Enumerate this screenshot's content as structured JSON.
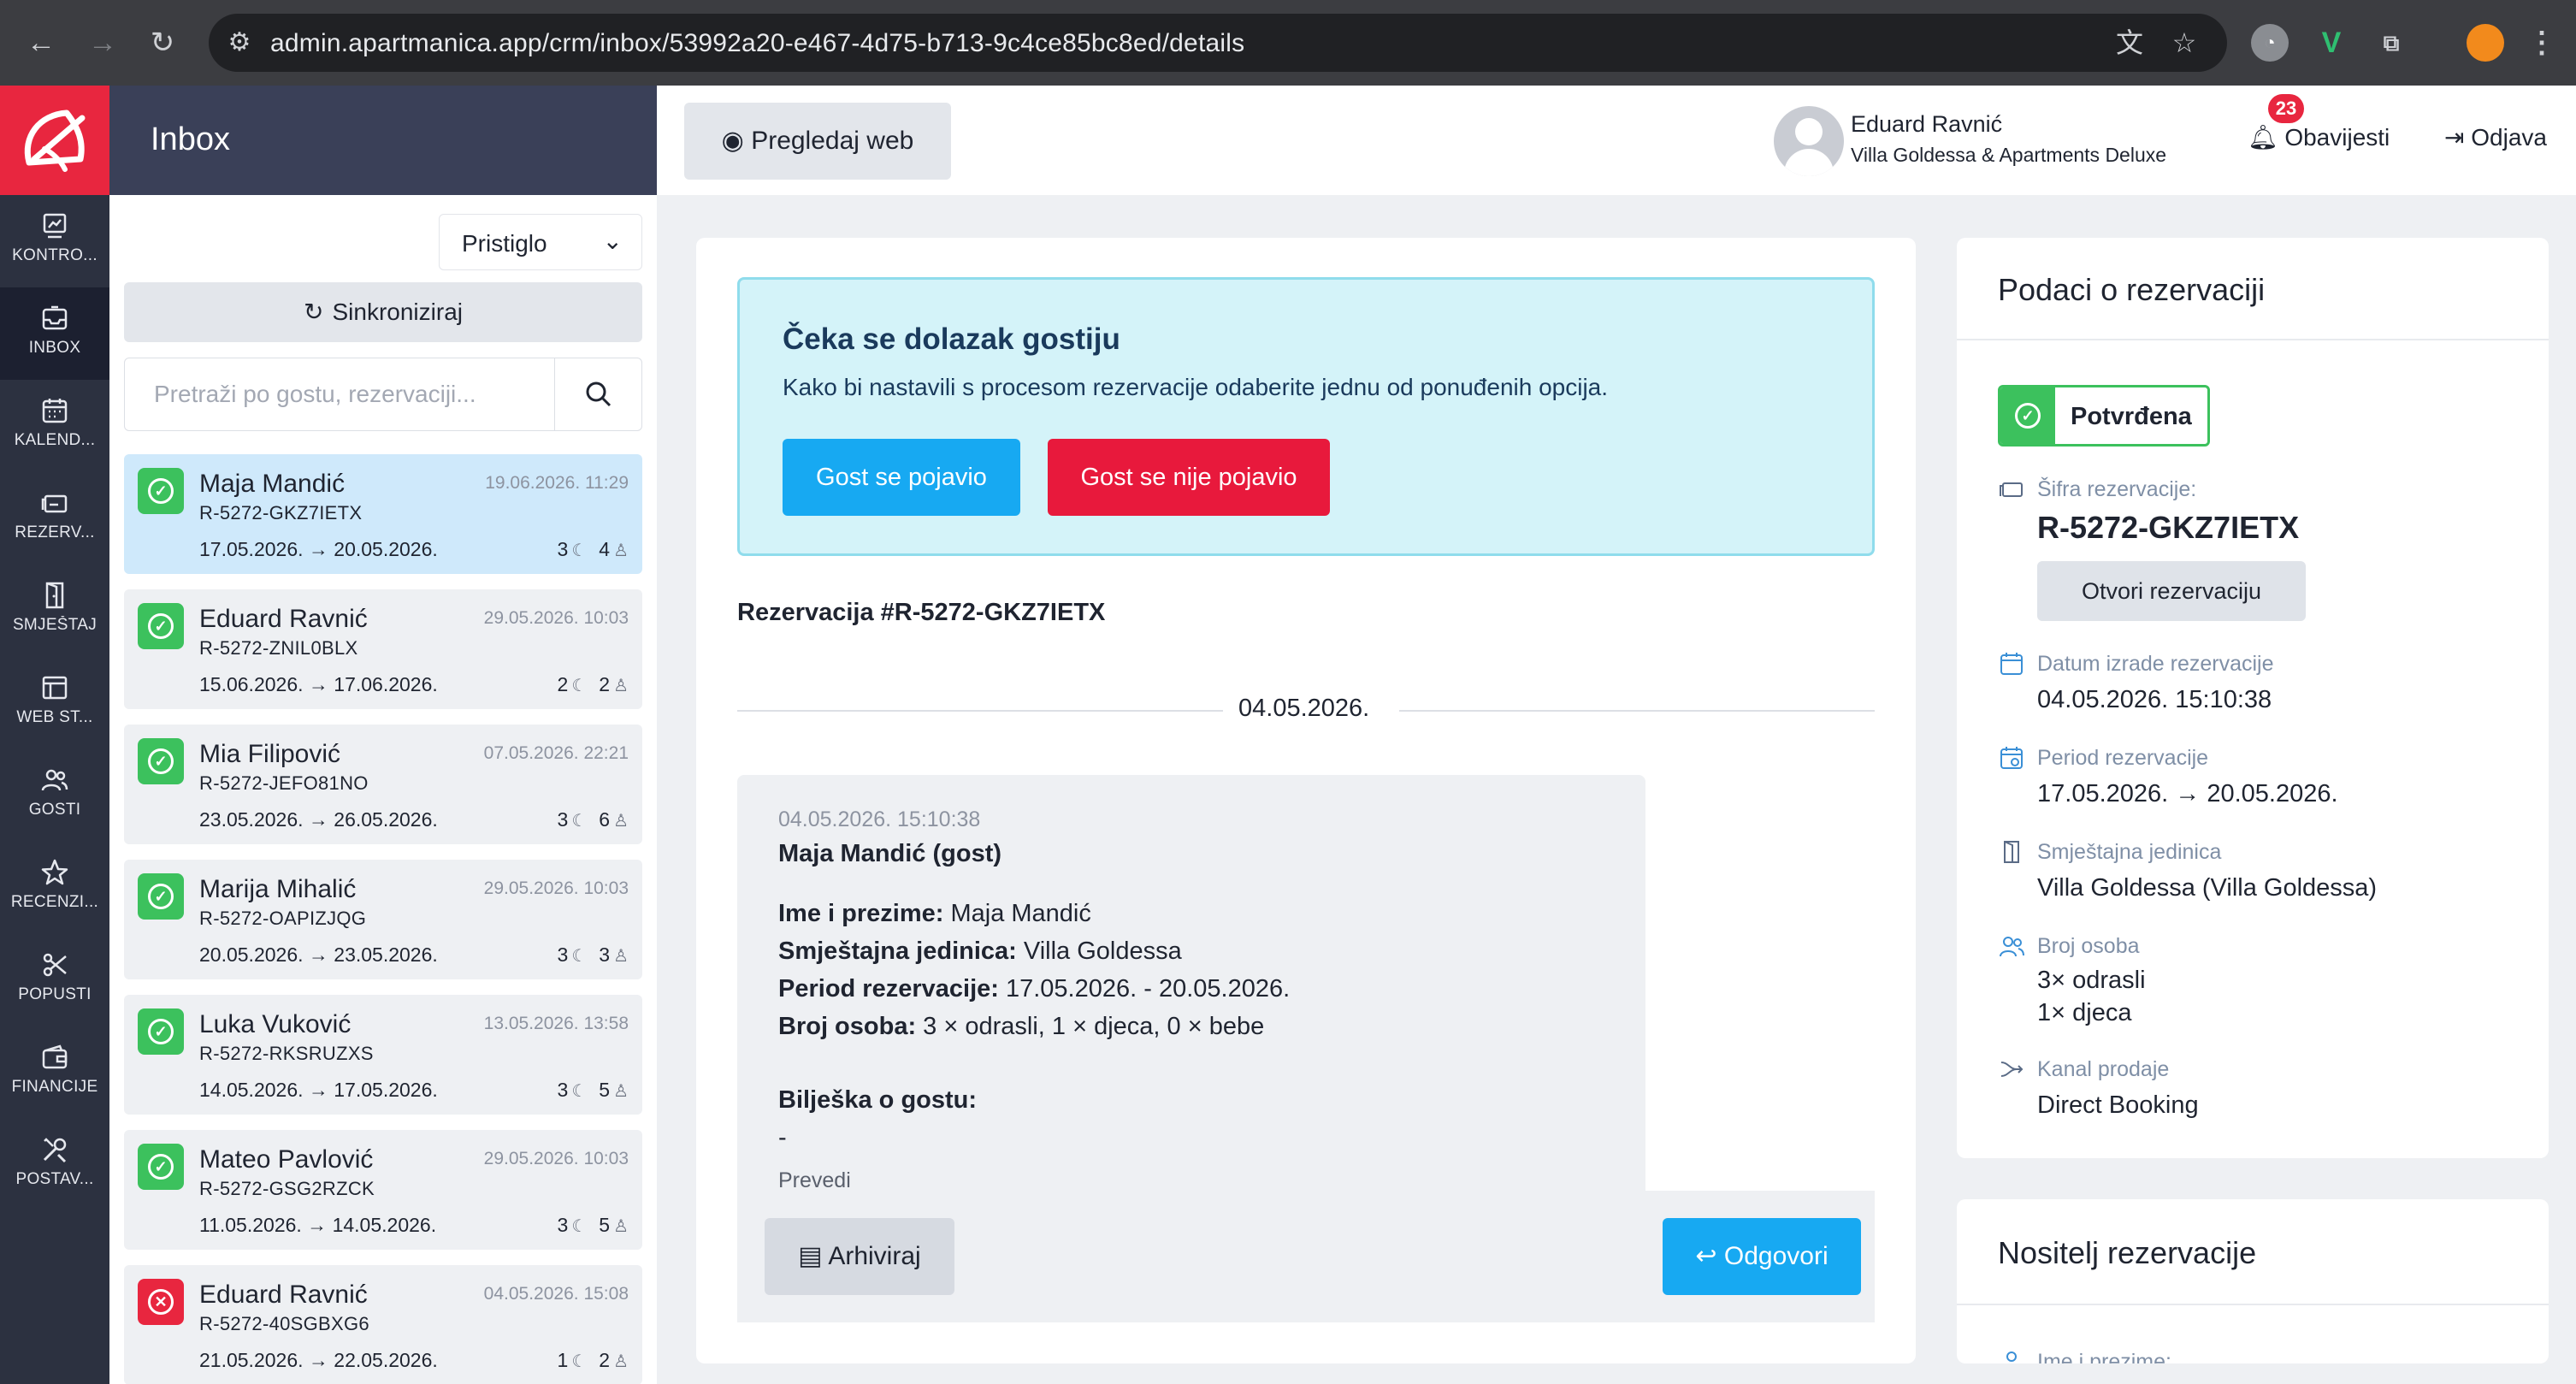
{
  "browser": {
    "url": "admin.apartmanica.app/crm/inbox/53992a20-e467-4d75-b713-9c4ce85bc8ed/details"
  },
  "rail": {
    "items": [
      {
        "label": "KONTRO...",
        "icon": "dashboard-icon"
      },
      {
        "label": "INBOX",
        "icon": "inbox-icon",
        "active": true
      },
      {
        "label": "KALEND...",
        "icon": "calendar-icon"
      },
      {
        "label": "REZERV...",
        "icon": "reservations-icon"
      },
      {
        "label": "SMJEŠTAJ",
        "icon": "door-icon"
      },
      {
        "label": "WEB ST...",
        "icon": "web-icon"
      },
      {
        "label": "GOSTI",
        "icon": "guests-icon"
      },
      {
        "label": "RECENZI...",
        "icon": "star-icon"
      },
      {
        "label": "POPUSTI",
        "icon": "discount-icon"
      },
      {
        "label": "FINANCIJE",
        "icon": "wallet-icon"
      },
      {
        "label": "POSTAV...",
        "icon": "tools-icon"
      }
    ]
  },
  "inbox": {
    "title": "Inbox",
    "filter_value": "Pristiglo",
    "sync_label": "Sinkroniziraj",
    "search_placeholder": "Pretraži po gostu, rezervaciji...",
    "conversations": [
      {
        "name": "Maja Mandić",
        "date": "19.06.2026. 11:29",
        "code": "R-5272-GKZ7IETX",
        "period": "17.05.2026. → 20.05.2026.",
        "nights": "3",
        "guests": "4",
        "status": "confirmed",
        "active": true
      },
      {
        "name": "Eduard Ravnić",
        "date": "29.05.2026. 10:03",
        "code": "R-5272-ZNIL0BLX",
        "period": "15.06.2026. → 17.06.2026.",
        "nights": "2",
        "guests": "2",
        "status": "confirmed"
      },
      {
        "name": "Mia Filipović",
        "date": "07.05.2026. 22:21",
        "code": "R-5272-JEFO81NO",
        "period": "23.05.2026. → 26.05.2026.",
        "nights": "3",
        "guests": "6",
        "status": "confirmed"
      },
      {
        "name": "Marija Mihalić",
        "date": "29.05.2026. 10:03",
        "code": "R-5272-OAPIZJQG",
        "period": "20.05.2026. → 23.05.2026.",
        "nights": "3",
        "guests": "3",
        "status": "confirmed"
      },
      {
        "name": "Luka Vuković",
        "date": "13.05.2026. 13:58",
        "code": "R-5272-RKSRUZXS",
        "period": "14.05.2026. → 17.05.2026.",
        "nights": "3",
        "guests": "5",
        "status": "confirmed"
      },
      {
        "name": "Mateo Pavlović",
        "date": "29.05.2026. 10:03",
        "code": "R-5272-GSG2RZCK",
        "period": "11.05.2026. → 14.05.2026.",
        "nights": "3",
        "guests": "5",
        "status": "confirmed"
      },
      {
        "name": "Eduard Ravnić",
        "date": "04.05.2026. 15:08",
        "code": "R-5272-40SGBXG6",
        "period": "21.05.2026. → 22.05.2026.",
        "nights": "1",
        "guests": "2",
        "status": "rejected"
      }
    ]
  },
  "topbar": {
    "preview_label": "Pregledaj web",
    "user_name": "Eduard Ravnić",
    "property_name": "Villa Goldessa & Apartments Deluxe",
    "notifications_label": "Obavijesti",
    "notifications_count": "23",
    "logout_label": "Odjava"
  },
  "main": {
    "alert_title": "Čeka se dolazak gostiju",
    "alert_text": "Kako bi nastavili s procesom rezervacije odaberite jednu od ponuđenih opcija.",
    "guest_arrived_label": "Gost se pojavio",
    "guest_no_show_label": "Gost se nije pojavio",
    "reservation_heading": "Rezervacija #R-5272-GKZ7IETX",
    "divider_date": "04.05.2026.",
    "message": {
      "time": "04.05.2026. 15:10:38",
      "author": "Maja Mandić (gost)",
      "fields": [
        {
          "label": "Ime i prezime:",
          "value": " Maja Mandić"
        },
        {
          "label": "Smještajna jedinica:",
          "value": " Villa Goldessa"
        },
        {
          "label": "Period rezervacije:",
          "value": " 17.05.2026. - 20.05.2026."
        },
        {
          "label": "Broj osoba:",
          "value": " 3 × odrasli, 1 × djeca, 0 × bebe"
        }
      ],
      "note_label": "Bilješka o gostu:",
      "note_value": "-",
      "translate_label": "Prevedi"
    },
    "archive_label": "Arhiviraj",
    "reply_label": "Odgovori"
  },
  "reservation_panel": {
    "title": "Podaci o rezervaciji",
    "status": "Potvrđena",
    "code_label": "Šifra rezervacije:",
    "code": "R-5272-GKZ7IETX",
    "open_label": "Otvori rezervaciju",
    "created_label": "Datum izrade rezervacije",
    "created_value": "04.05.2026. 15:10:38",
    "period_label": "Period rezervacije",
    "period_value": "17.05.2026. → 20.05.2026.",
    "unit_label": "Smještajna jedinica",
    "unit_value": "Villa Goldessa (Villa Goldessa)",
    "persons_label": "Broj osoba",
    "adults": "3× odrasli",
    "children": "1× djeca",
    "channel_label": "Kanal prodaje",
    "channel_value": "Direct Booking"
  },
  "holder_panel": {
    "title": "Nositelj rezervacije",
    "name_label": "Ime i prezime:"
  },
  "colors": {
    "brand_red": "#e8263f",
    "sidebar_dark": "#2c3140",
    "accent_blue": "#17a9f2",
    "success_green": "#3cc15d",
    "alert_bg": "#d4f3f9"
  }
}
